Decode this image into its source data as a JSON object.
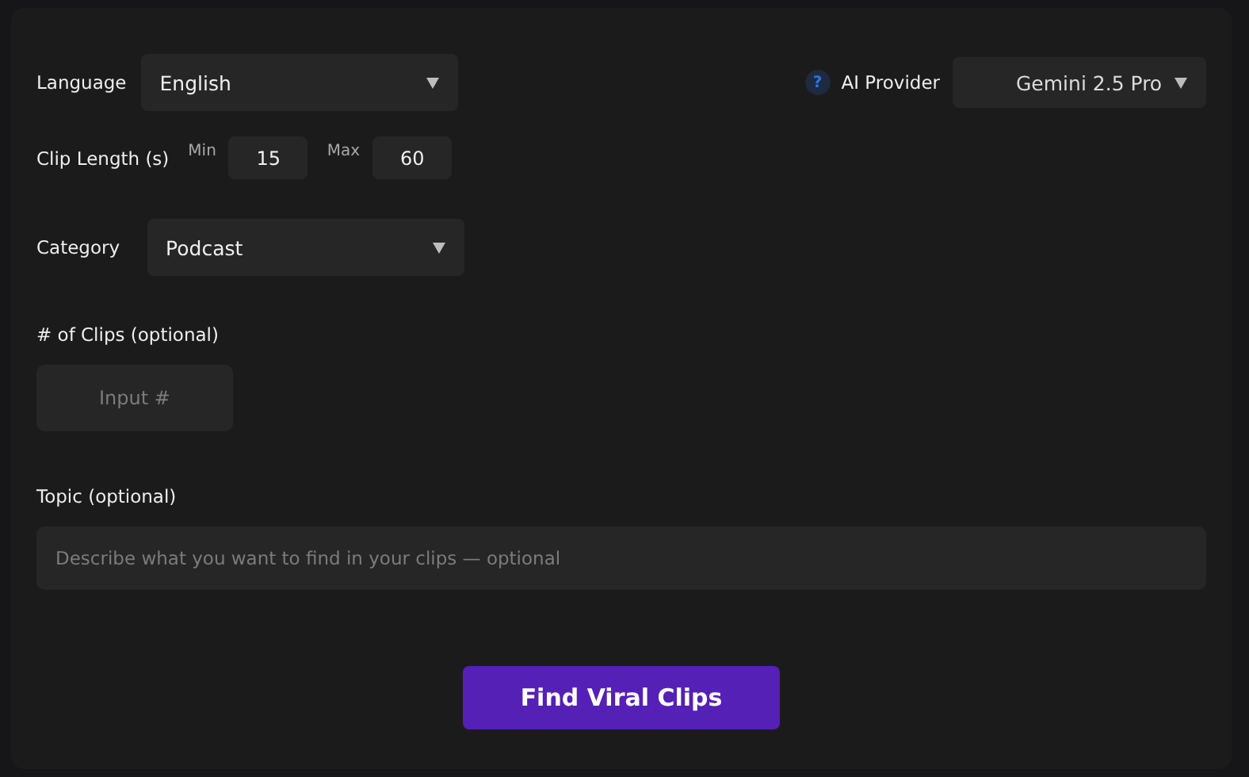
{
  "language": {
    "label": "Language",
    "value": "English"
  },
  "ai_provider": {
    "help_icon": "?",
    "label": "AI Provider",
    "value": "Gemini 2.5 Pro"
  },
  "clip_length": {
    "label": "Clip Length (s)",
    "min_label": "Min",
    "min_value": "15",
    "max_label": "Max",
    "max_value": "60"
  },
  "category": {
    "label": "Category",
    "value": "Podcast"
  },
  "clip_count": {
    "label": "# of Clips (optional)",
    "placeholder": "Input #"
  },
  "topic": {
    "label": "Topic (optional)",
    "placeholder": "Describe what you want to find in your clips — optional"
  },
  "submit_button": {
    "label": "Find Viral Clips"
  }
}
